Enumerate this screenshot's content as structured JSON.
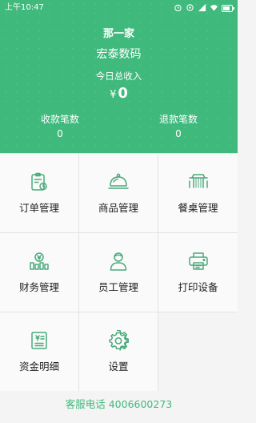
{
  "status_bar": {
    "time": "上午10:47"
  },
  "header": {
    "title": "那一家",
    "shop_name": "宏泰数码",
    "income_label": "今日总收入",
    "currency": "¥",
    "income_value": "0",
    "stats": [
      {
        "label": "收款笔数",
        "value": "0"
      },
      {
        "label": "退款笔数",
        "value": "0"
      }
    ]
  },
  "menu": [
    {
      "label": "订单管理",
      "icon": "order-icon"
    },
    {
      "label": "商品管理",
      "icon": "dish-cover-icon"
    },
    {
      "label": "餐桌管理",
      "icon": "table-icon"
    },
    {
      "label": "财务管理",
      "icon": "finance-icon"
    },
    {
      "label": "员工管理",
      "icon": "staff-icon"
    },
    {
      "label": "打印设备",
      "icon": "printer-icon"
    },
    {
      "label": "资金明细",
      "icon": "fund-detail-icon"
    },
    {
      "label": "设置",
      "icon": "settings-icon"
    }
  ],
  "footer": {
    "service_phone": "客服电话 4006600273"
  },
  "colors": {
    "accent": "#3fb97c",
    "icon_line": "#4aa97a"
  }
}
